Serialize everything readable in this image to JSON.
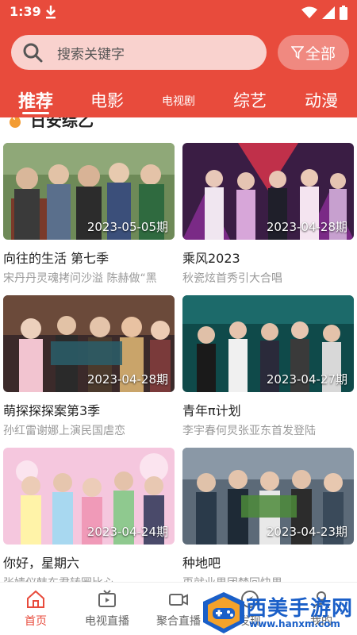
{
  "status": {
    "time": "1:39"
  },
  "search": {
    "placeholder": "搜索关键字"
  },
  "filter": {
    "label": "全部"
  },
  "tabs": [
    "推荐",
    "电影",
    "电视剧",
    "综艺",
    "动漫"
  ],
  "section": {
    "title": "日安综乙"
  },
  "cards": [
    {
      "date": "2023-05-05期",
      "title": "向往的生活 第七季",
      "desc": "宋丹丹灵魂拷问沙溢 陈赫做“黑"
    },
    {
      "date": "2023-04-28期",
      "title": "乘风2023",
      "desc": "秋瓷炫首秀引大合唱"
    },
    {
      "date": "2023-04-28期",
      "title": "萌探探探案第3季",
      "desc": "孙红雷谢娜上演民国虐恋"
    },
    {
      "date": "2023-04-27期",
      "title": "青年π计划",
      "desc": "李宇春何炅张亚东首发登陆"
    },
    {
      "date": "2023-04-24期",
      "title": "你好，星期六",
      "desc": "张婧仪韩东君转圈比心"
    },
    {
      "date": "2023-04-23期",
      "title": "种地吧",
      "desc": "再就业男团梦回快男"
    }
  ],
  "nav": [
    "首页",
    "电视直播",
    "聚合直播",
    "发现",
    "我的"
  ],
  "watermark": {
    "text": "西美手游网",
    "url": "www.hanxm.com"
  },
  "colors": {
    "accent": "#e84b3c",
    "watermark": "#1a5fc8"
  }
}
